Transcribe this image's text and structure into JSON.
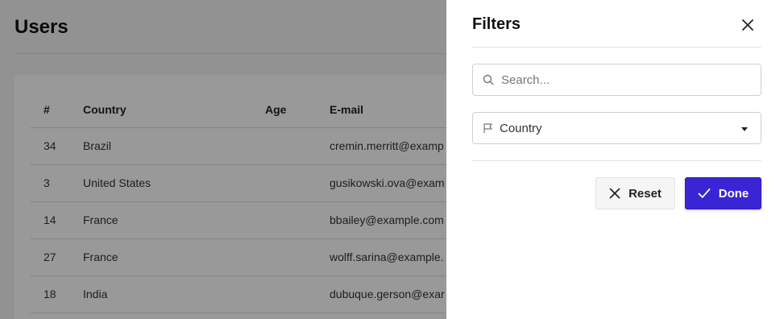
{
  "page": {
    "title": "Users"
  },
  "table": {
    "columns": [
      "#",
      "Country",
      "Age",
      "E-mail"
    ],
    "rows": [
      {
        "id": "34",
        "country": "Brazil",
        "age": "",
        "email": "cremin.merritt@examp"
      },
      {
        "id": "3",
        "country": "United States",
        "age": "",
        "email": "gusikowski.ova@exam"
      },
      {
        "id": "14",
        "country": "France",
        "age": "",
        "email": "bbailey@example.com"
      },
      {
        "id": "27",
        "country": "France",
        "age": "",
        "email": "wolff.sarina@example."
      },
      {
        "id": "18",
        "country": "India",
        "age": "",
        "email": "dubuque.gerson@exar"
      }
    ]
  },
  "drawer": {
    "title": "Filters",
    "search": {
      "placeholder": "Search...",
      "value": ""
    },
    "country_select": {
      "label": "Country"
    },
    "reset_label": "Reset",
    "done_label": "Done"
  },
  "icons": {
    "close": "close-icon",
    "search": "search-icon",
    "flag": "flag-icon",
    "reset": "x-icon",
    "done": "check-icon"
  },
  "colors": {
    "accent": "#3a25d4",
    "overlay": "rgba(0,0,0,0.4)"
  }
}
